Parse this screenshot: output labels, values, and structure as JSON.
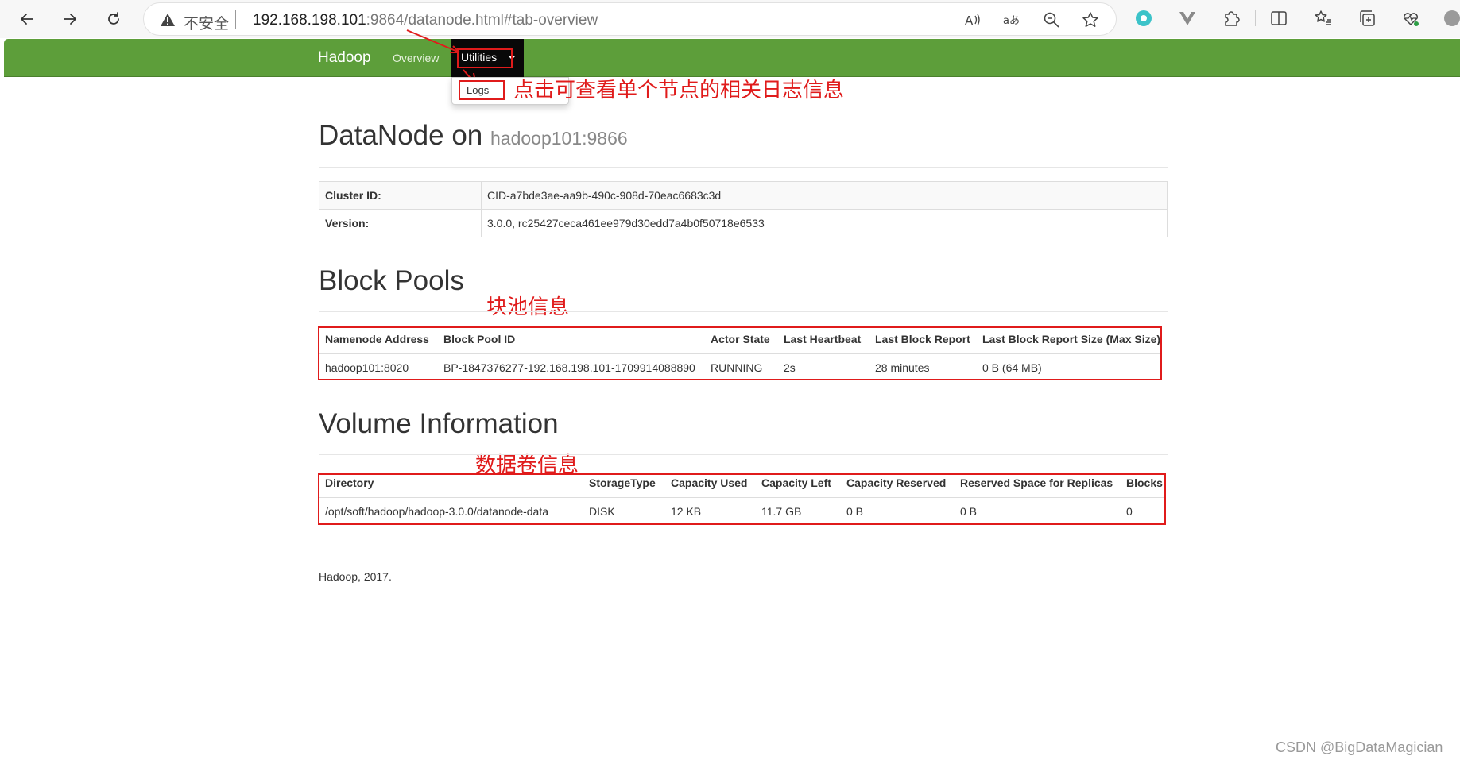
{
  "browser": {
    "insecure_label": "不安全",
    "url_host": "192.168.198.101",
    "url_rest": ":9864/datanode.html#tab-overview"
  },
  "navbar": {
    "brand": "Hadoop",
    "overview": "Overview",
    "utilities": "Utilities",
    "dropdown_item": "Logs"
  },
  "annotations": {
    "logs_note": "点击可查看单个节点的相关日志信息",
    "block_pools_note": "块池信息",
    "volume_note": "数据卷信息"
  },
  "header": {
    "title": "DataNode on",
    "host": "hadoop101:9866"
  },
  "info": {
    "rows": [
      {
        "key": "Cluster ID:",
        "value": "CID-a7bde3ae-aa9b-490c-908d-70eac6683c3d"
      },
      {
        "key": "Version:",
        "value": "3.0.0, rc25427ceca461ee979d30edd7a4b0f50718e6533"
      }
    ]
  },
  "block_pools": {
    "heading": "Block Pools",
    "columns": [
      "Namenode Address",
      "Block Pool ID",
      "Actor State",
      "Last Heartbeat",
      "Last Block Report",
      "Last Block Report Size (Max Size)"
    ],
    "rows": [
      [
        "hadoop101:8020",
        "BP-1847376277-192.168.198.101-1709914088890",
        "RUNNING",
        "2s",
        "28 minutes",
        "0 B (64 MB)"
      ]
    ]
  },
  "volumes": {
    "heading": "Volume Information",
    "columns": [
      "Directory",
      "StorageType",
      "Capacity Used",
      "Capacity Left",
      "Capacity Reserved",
      "Reserved Space for Replicas",
      "Blocks"
    ],
    "rows": [
      [
        "/opt/soft/hadoop/hadoop-3.0.0/datanode-data",
        "DISK",
        "12 KB",
        "11.7 GB",
        "0 B",
        "0 B",
        "0"
      ]
    ]
  },
  "footer": "Hadoop, 2017.",
  "watermark": "CSDN @BigDataMagician",
  "colors": {
    "navbar": "#5d9e3a",
    "annotation": "#e01b1b",
    "active_nav": "#080808"
  }
}
